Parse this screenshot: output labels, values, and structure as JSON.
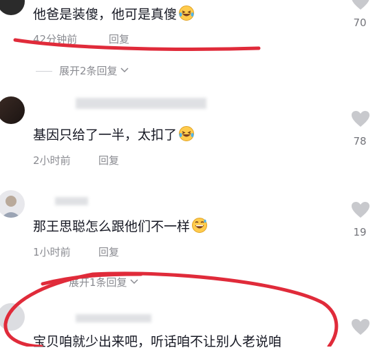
{
  "accent": {
    "like_gray": "#c8c9cd",
    "annotation_red": "#e02b3a"
  },
  "comments": [
    {
      "text": "他爸是装傻，他可是真傻",
      "emoji": "laughing-tears-emoji",
      "time": "42分钟前",
      "reply": "回复",
      "likes": "70",
      "expand": "展开2条回复"
    },
    {
      "text": "基因只给了一半，太扣了",
      "emoji": "laughing-tears-emoji",
      "time": "2小时前",
      "reply": "回复",
      "likes": "78"
    },
    {
      "text": "那王思聪怎么跟他们不一样",
      "emoji": "grinning-sweat-emoji",
      "time": "1小时前",
      "reply": "回复",
      "likes": "19",
      "expand": "展开1条回复"
    },
    {
      "text": "宝贝咱就少出来吧，听话咱不让别人老说咱"
    }
  ]
}
